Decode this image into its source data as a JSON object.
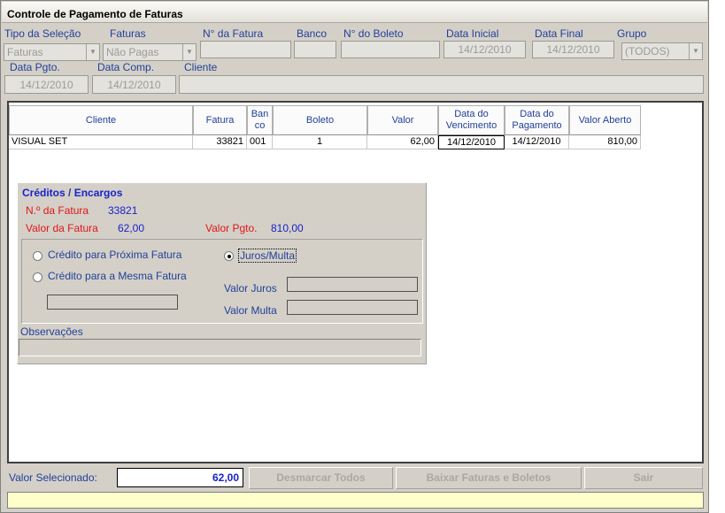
{
  "window": {
    "title": "Controle de Pagamento de Faturas"
  },
  "filters": {
    "tipo_selecao": {
      "label": "Tipo da Seleção",
      "value": "Faturas"
    },
    "faturas": {
      "label": "Faturas",
      "value": "Não Pagas"
    },
    "num_fatura": {
      "label": "N° da Fatura",
      "value": ""
    },
    "banco": {
      "label": "Banco",
      "value": ""
    },
    "num_boleto": {
      "label": "N° do Boleto",
      "value": ""
    },
    "data_inicial": {
      "label": "Data Inicial",
      "value": "14/12/2010"
    },
    "data_final": {
      "label": "Data Final",
      "value": "14/12/2010"
    },
    "grupo": {
      "label": "Grupo",
      "value": "(TODOS)"
    },
    "data_pgto": {
      "label": "Data Pgto.",
      "value": "14/12/2010"
    },
    "data_comp": {
      "label": "Data Comp.",
      "value": "14/12/2010"
    },
    "cliente": {
      "label": "Cliente",
      "value": ""
    }
  },
  "table": {
    "headers": {
      "cliente": "Cliente",
      "fatura": "Fatura",
      "banco_1": "Ban",
      "banco_2": "co",
      "boleto": "Boleto",
      "valor": "Valor",
      "venc_1": "Data do",
      "venc_2": "Vencimento",
      "pag_1": "Data do",
      "pag_2": "Pagamento",
      "aberto": "Valor Aberto"
    },
    "rows": [
      {
        "cliente": "VISUAL SET",
        "fatura": "33821",
        "banco": "001",
        "boleto": "1",
        "valor": "62,00",
        "vencimento": "14/12/2010",
        "pagamento": "14/12/2010",
        "aberto": "810,00"
      }
    ]
  },
  "creditos": {
    "title_a": "Créditos",
    "title_sep": " / ",
    "title_b": "Encargos",
    "num_fatura_label": "N.º da Fatura",
    "num_fatura_value": "33821",
    "valor_fatura_label": "Valor da Fatura",
    "valor_fatura_value": "62,00",
    "valor_pgto_label": "Valor Pgto.",
    "valor_pgto_value": "810,00",
    "opt_proxima": "Crédito para Próxima Fatura",
    "opt_mesma": "Crédito para a Mesma Fatura",
    "opt_juros": "Juros/Multa",
    "valor_juros_label": "Valor Juros",
    "valor_multa_label": "Valor Multa",
    "obs_label": "Observações"
  },
  "footer": {
    "valor_selecionado_label": "Valor Selecionado:",
    "valor_selecionado_value": "62,00",
    "desmarcar_label": "Desmarcar Todos",
    "baixar_label": "Baixar Faturas e Boletos",
    "sair_label": "Sair"
  },
  "colors": {
    "label_blue": "#21409a",
    "label_red": "#e0161a",
    "value_blue": "#1a22c8",
    "status_yellow": "#ffffcc"
  }
}
